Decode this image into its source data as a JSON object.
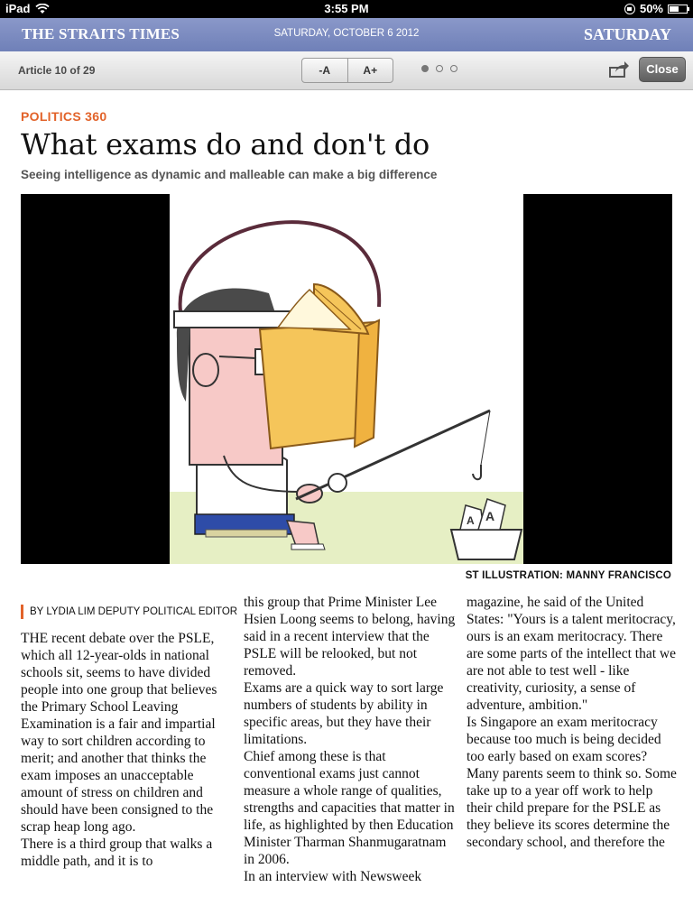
{
  "status_bar": {
    "device": "iPad",
    "time": "3:55 PM",
    "battery": "50%",
    "battery_level": 0.5
  },
  "masthead": {
    "brand": "THE STRAITS TIMES",
    "date": "SATURDAY, OCTOBER 6 2012",
    "day": "SATURDAY"
  },
  "toolbar": {
    "article_count": "Article 10 of 29",
    "font_decrease": "-A",
    "font_increase": "A+",
    "pages": 3,
    "current_page": 1,
    "share_icon": "share-icon",
    "close_label": "Close"
  },
  "article": {
    "section": "POLITICS 360",
    "headline": "What exams do and don't do",
    "subhead": "Seeing intelligence as dynamic and malleable can make a big difference",
    "image_caption": "ST ILLUSTRATION: MANNY FRANCISCO",
    "byline": "BY LYDIA LIM DEPUTY POLITICAL EDITOR",
    "col1": [
      "THE recent debate over the PSLE, which all 12-year-olds in national schools sit, seems to have divided people into one group that believes the Primary School Leaving Examination is a fair and impartial way to sort children according to merit; and another that thinks the exam imposes an unacceptable amount of stress on children and should have been consigned to the scrap heap long ago.",
      " There is a third group that walks a middle path, and it is to"
    ],
    "col2": [
      "this group that Prime Minister Lee Hsien Loong seems to belong, having said in a recent interview that the PSLE will be relooked, but not removed.",
      " Exams are a quick way to sort large numbers of students by ability in specific areas, but they have their limitations.",
      " Chief among these is that conventional exams just cannot measure a whole range of qualities, strengths and capacities that matter in life, as highlighted by then Education Minister Tharman Shanmugaratnam in 2006.",
      " In an interview with Newsweek"
    ],
    "col3": [
      "magazine, he said of the United States: \"Yours is a talent meritocracy, ours is an exam meritocracy. There are some parts of the intellect that we are not able to test well - like creativity, curiosity, a sense of adventure, ambition.\"",
      " Is Singapore an exam meritocracy because too much is being decided too early based on exam scores?",
      " Many parents seem to think so. Some take up to a year off work to help their child prepare for the PSLE as they believe its scores determine the secondary school, and therefore the"
    ]
  },
  "colors": {
    "accent": "#e2632a",
    "masthead": "#7a89bf",
    "book": "#f5c55a"
  }
}
